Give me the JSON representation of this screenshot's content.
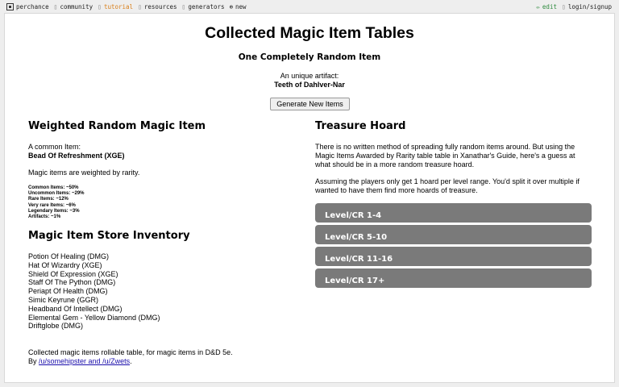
{
  "nav": {
    "brand": "perchance",
    "items": [
      "community",
      "tutorial",
      "resources",
      "generators",
      "new"
    ],
    "edit": "edit",
    "login": "login/signup"
  },
  "header": {
    "title": "Collected Magic Item Tables",
    "subtitle": "One Completely Random Item",
    "artifact_line": "An unique artifact:",
    "artifact_name": "Teeth of Dahlver-Nar",
    "generate_button": "Generate New Items"
  },
  "weighted": {
    "heading": "Weighted Random Magic Item",
    "common_line": "A common Item:",
    "item": "Bead Of Refreshment (XGE)",
    "note": "Magic items are weighted by rarity.",
    "rarities": [
      "Common Items: ~50%",
      "Uncommon Items: ~29%",
      "Rare Items: ~12%",
      "Very rare Items: ~6%",
      "Legendary Items: ~3%",
      "Artifacts: ~1%"
    ]
  },
  "store": {
    "heading": "Magic Item Store Inventory",
    "items": [
      "Potion Of Healing (DMG)",
      "Hat Of Wizardry (XGE)",
      "Shield Of Expression (XGE)",
      "Staff Of The Python (DMG)",
      "Periapt Of Health (DMG)",
      "Simic Keyrune (GGR)",
      "Headband Of Intellect (DMG)",
      "Elemental Gem - Yellow Diamond (DMG)",
      "Driftglobe (DMG)"
    ]
  },
  "footer": {
    "line1": "Collected magic items rollable table, for magic items in D&D 5e.",
    "by": "By ",
    "link1": "/u/somehipster",
    "and": " and ",
    "link2": "/u/Zwets",
    "end": "."
  },
  "hoard": {
    "heading": "Treasure Hoard",
    "p1": "There is no written method of spreading fully random items around. But using the Magic Items Awarded by Rarity table table in Xanathar's Guide, here's a guess at what should be in a more random treasure hoard.",
    "p2": "Assuming the players only get 1 hoard per level range. You'd split it over multiple if wanted to have them find more hoards of treasure.",
    "levels": [
      "Level/CR 1-4",
      "Level/CR 5-10",
      "Level/CR 11-16",
      "Level/CR 17+"
    ]
  }
}
